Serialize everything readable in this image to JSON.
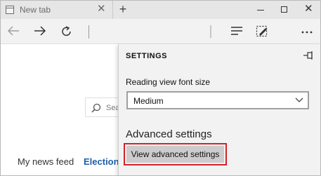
{
  "tab": {
    "title": "New tab",
    "close": "✕"
  },
  "new_tab": "+",
  "window": {
    "minimize": "",
    "maximize": "",
    "close": "✕"
  },
  "page": {
    "search_placeholder": "Sea",
    "news_feed": "My news feed",
    "election": "Election"
  },
  "settings": {
    "title": "SETTINGS",
    "font_label": "Reading view font size",
    "font_value": "Medium",
    "advanced_heading": "Advanced settings",
    "advanced_button": "View advanced settings"
  },
  "colors": {
    "highlight": "#d1232a",
    "link": "#1f5ea8"
  }
}
